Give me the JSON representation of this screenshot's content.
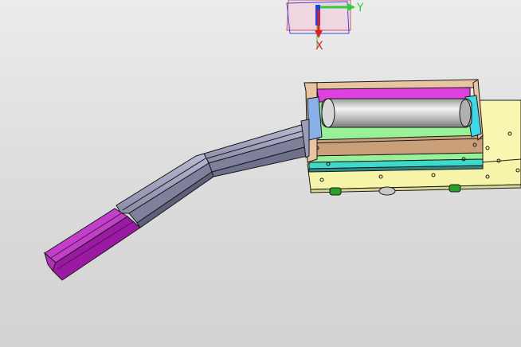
{
  "viewport": {
    "background_top": "#ececec",
    "background_bottom": "#d2d2d2"
  },
  "triad": {
    "y_label": "Y",
    "x_label": "X",
    "y_color": "#2ecc40",
    "x_color": "#e02020",
    "z_color": "#2040e0"
  },
  "model": {
    "base_plate_color": "#f6f4a8",
    "housing_color": "#c9a07a",
    "inner_plate_color": "#98f098",
    "magenta_color": "#d040d0",
    "cyan_color": "#40d8e8",
    "roller_color": "#c8c8c8",
    "chute_color": "#9a9cb8",
    "handle_color": "#a020a8",
    "foot_color": "#2aa02a"
  }
}
